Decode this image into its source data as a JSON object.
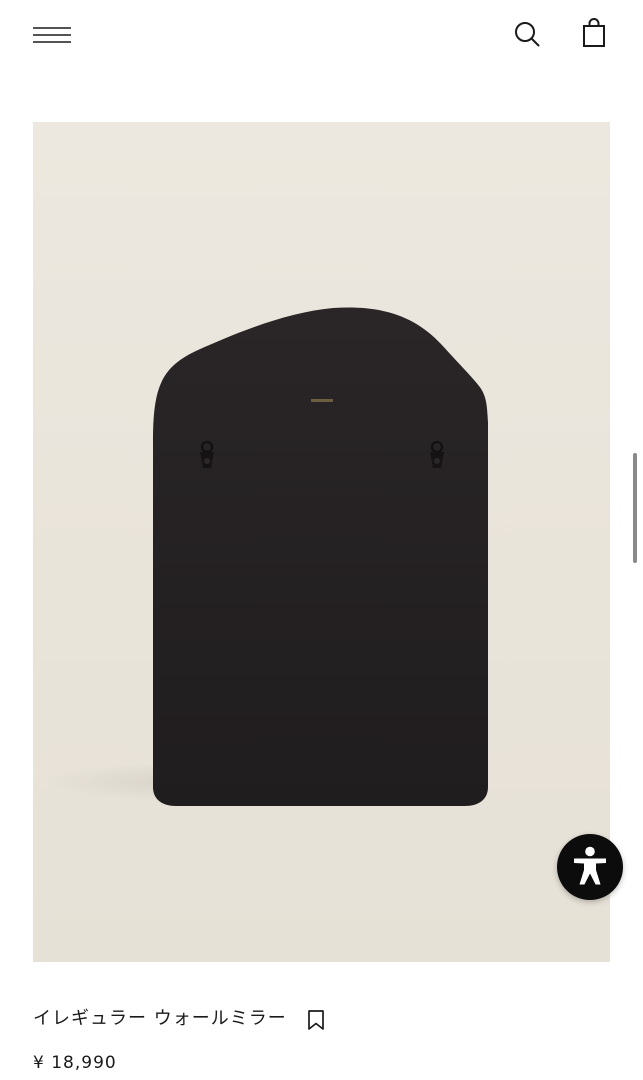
{
  "header": {
    "menu_icon": "hamburger-menu-icon",
    "search_icon": "search-icon",
    "cart_icon": "shopping-bag-icon"
  },
  "product": {
    "title": "イレギュラー ウォールミラー",
    "price": "¥ 18,990",
    "bookmark_icon": "bookmark-icon",
    "image_description_icon": "mirror-back-image"
  },
  "accessibility": {
    "icon": "accessibility-icon"
  },
  "colors": {
    "background": "#ffffff",
    "image_background": "#e9e4da",
    "mirror_back": "#252223",
    "text": "#1a1a1a",
    "a11y_button": "#0c0c0c"
  }
}
